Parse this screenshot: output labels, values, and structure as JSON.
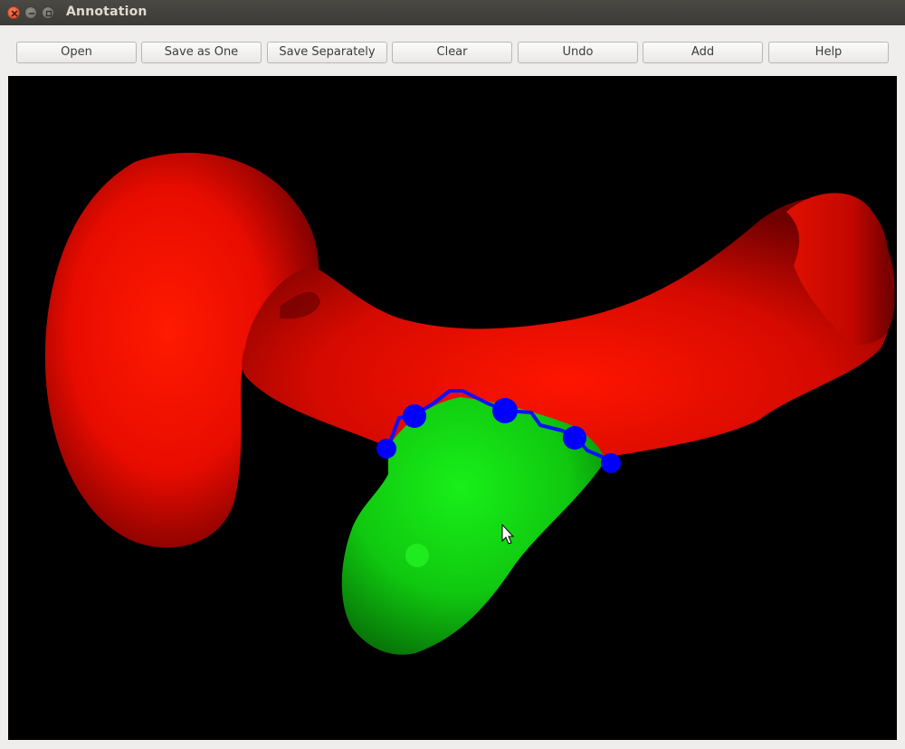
{
  "window": {
    "title": "Annotation"
  },
  "toolbar": {
    "open": "Open",
    "save_as_one": "Save as One",
    "save_separately": "Save Separately",
    "clear": "Clear",
    "undo": "Undo",
    "add": "Add",
    "help": "Help"
  },
  "icons": {
    "close": "close-icon",
    "minimize": "minimize-icon",
    "maximize": "maximize-icon",
    "cursor": "mouse-pointer-icon"
  },
  "colors": {
    "mesh_red": "#ff1000",
    "mesh_green": "#14e614",
    "annotation_blue": "#0000ff",
    "viewport_background": "#000000"
  }
}
